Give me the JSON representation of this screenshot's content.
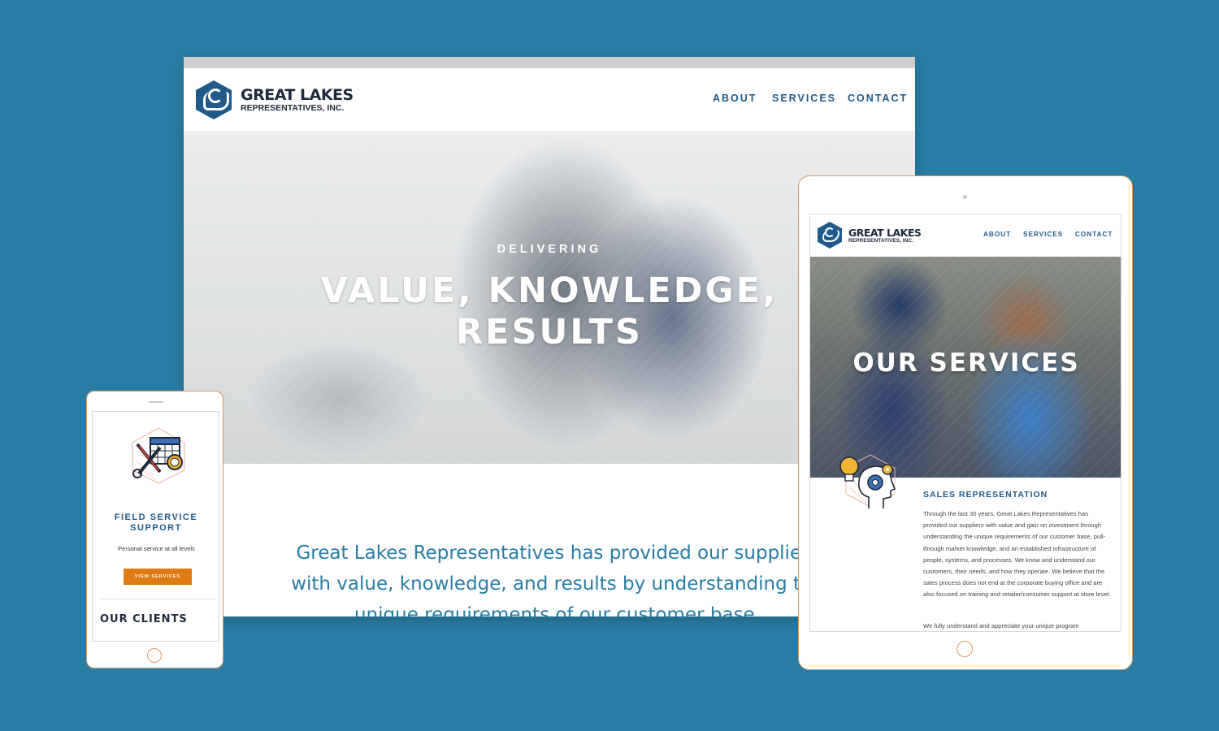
{
  "brand": {
    "name": "GREAT LAKES",
    "sub": "REPRESENTATIVES, INC."
  },
  "nav": {
    "items": [
      "ABOUT",
      "SERVICES",
      "CONTACT"
    ]
  },
  "desktop": {
    "hero_kicker": "DELIVERING",
    "hero_line1": "VALUE, KNOWLEDGE,",
    "hero_line2": "RESULTS",
    "intro": "Great Lakes Representatives has provided our suppliers with value, knowledge, and results by understanding the unique requirements of our customer base."
  },
  "phone": {
    "card_title": "FIELD SERVICE SUPPORT",
    "card_text": "Personal service at all levels",
    "button": "VIEW SERVICES",
    "section_title": "OUR CLIENTS"
  },
  "tablet": {
    "hero_title": "OUR SERVICES",
    "section_title": "SALES REPRESENTATION",
    "paragraph": "Through the last 30 years, Great Lakes Representatives has provided our suppliers with value and gain on investment through understanding the unique requirements of our customer base, pull-through market knowledge, and an established infrastructure of people, systems, and processes. We know and understand our customers, their needs, and how they operate. We believe that the sales process does not end at the corporate buying office and are also focused on training and retailer/consumer support at store level.",
    "paragraph2": "We fully understand and appreciate your unique program"
  },
  "colors": {
    "background": "#297ca3",
    "brand_blue": "#1f5a8a",
    "accent_orange": "#e07a12",
    "device_border": "#d49a63"
  },
  "icons": [
    "great-lakes-logo-icon",
    "tools-calendar-icon",
    "lightbulb-gear-head-icon"
  ]
}
